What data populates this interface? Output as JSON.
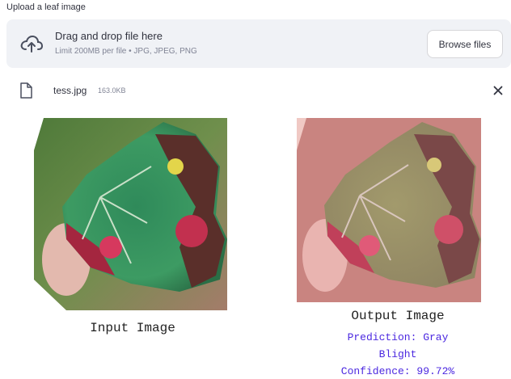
{
  "uploader": {
    "label": "Upload a leaf image",
    "drop_title": "Drag and drop file here",
    "drop_hint": "Limit 200MB per file • JPG, JPEG, PNG",
    "browse_label": "Browse files",
    "cloud_icon": "cloud-upload-icon"
  },
  "file": {
    "name": "tess.jpg",
    "size": "163.0KB",
    "file_icon": "file-icon",
    "close_icon": "close-icon"
  },
  "images": {
    "input_caption": "Input Image",
    "output_caption": "Output Image"
  },
  "result": {
    "prediction_line1": "Prediction: Gray",
    "prediction_line2": "Blight",
    "confidence": "Confidence: 99.72%"
  },
  "colors": {
    "dropzone_bg": "#f0f2f6",
    "prediction_text": "#4b28e0",
    "output_overlay": "#e8787a"
  }
}
